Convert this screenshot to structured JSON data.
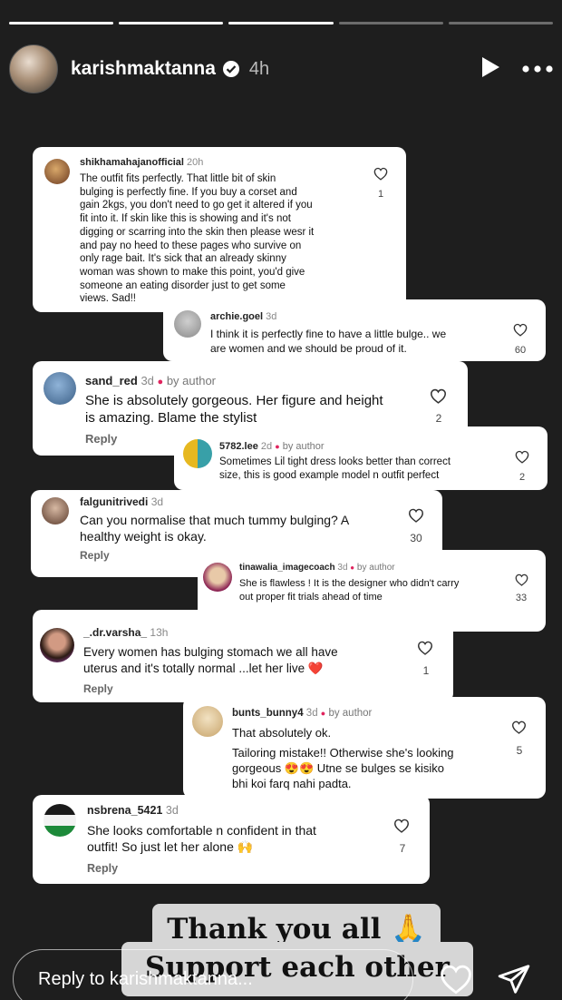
{
  "header": {
    "username": "karishmaktanna",
    "time": "4h"
  },
  "comments": [
    {
      "user": "shikhamahajanofficial",
      "time": "20h",
      "text": [
        "The outfit fits perfectly. That little bit of skin",
        "bulging is perfectly fine. If you buy a corset and",
        "gain 2kgs, you don't need to go get it altered if you",
        "fit into it. If skin like this is showing and it's not",
        "digging or scarring into the skin then please wesr it",
        "and pay no heed to these pages who survive on",
        "only rage bait. It's sick that an already skinny",
        "woman was shown to make this point, you'd give",
        "someone an eating disorder just to get some",
        "views. Sad!!"
      ],
      "likes": "1"
    },
    {
      "user": "archie.goel",
      "time": "3d",
      "text": [
        "I think it is perfectly fine to have a little bulge.. we",
        "are women and we should be proud of it."
      ],
      "likes": "60"
    },
    {
      "user": "sand_red",
      "time": "3d",
      "by": "by author",
      "text": [
        "She is absolutely  gorgeous.  Her figure and height",
        "is amazing. Blame the stylist"
      ],
      "likes": "2",
      "reply": "Reply"
    },
    {
      "user": "5782.lee",
      "time": "2d",
      "by": "by author",
      "text": [
        "Sometimes Lil tight dress looks better than correct",
        "size, this is good example model n outfit perfect"
      ],
      "likes": "2"
    },
    {
      "user": "falgunitrivedi",
      "time": "3d",
      "text": [
        "Can you normalise that much tummy bulging? A",
        "healthy weight is okay."
      ],
      "likes": "30",
      "reply": "Reply"
    },
    {
      "user": "tinawalia_imagecoach",
      "time": "3d",
      "by": "by author",
      "text": [
        "She is flawless ! It is the designer who didn't carry",
        "out proper fit trials ahead of time"
      ],
      "likes": "33"
    },
    {
      "user": "_.dr.varsha_",
      "time": "13h",
      "text": [
        "Every women has bulging stomach we all have",
        "uterus and it's totally normal ...let her live ❤️"
      ],
      "likes": "1",
      "reply": "Reply"
    },
    {
      "user": "bunts_bunny4",
      "time": "3d",
      "by": "by author",
      "text": [
        "That absolutely ok.",
        "Tailoring mistake!! Otherwise she's looking",
        "gorgeous 😍😍 Utne se bulges se kisiko",
        "bhi koi farq nahi padta."
      ],
      "likes": "5"
    },
    {
      "user": "nsbrena_5421",
      "time": "3d",
      "text": [
        "She looks comfortable n confident in that",
        "outfit! So just let her alone 🙌"
      ],
      "likes": "7",
      "reply": "Reply"
    }
  ],
  "caption": {
    "line1": "Thank you all 🙏",
    "line2": "Support each other"
  },
  "reply_bar": {
    "placeholder": "Reply to karishmaktanna..."
  },
  "colors": {
    "background": "#1e1e1e",
    "card": "#ffffff",
    "heart_red": "#e0245e"
  },
  "icons": [
    "verified-icon",
    "play-icon",
    "more-icon",
    "heart-icon",
    "send-icon"
  ]
}
